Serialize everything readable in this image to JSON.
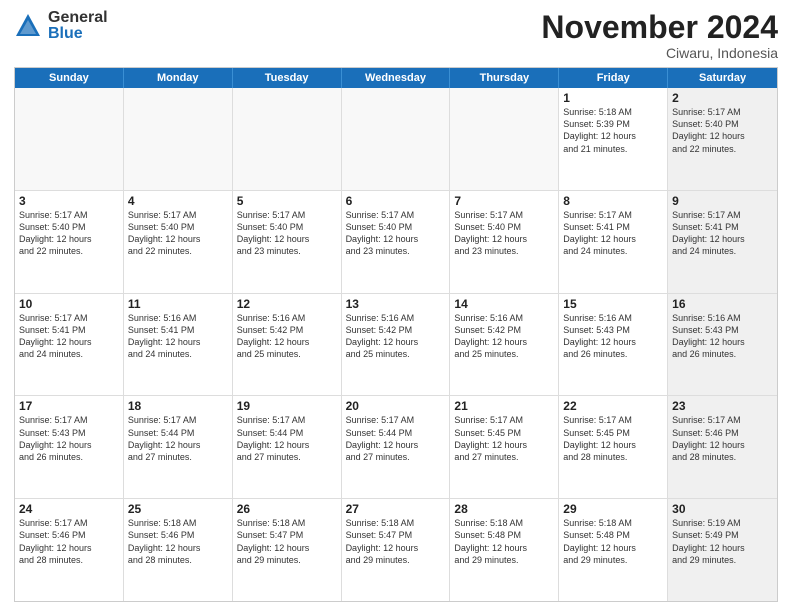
{
  "logo": {
    "general": "General",
    "blue": "Blue"
  },
  "header": {
    "month": "November 2024",
    "location": "Ciwaru, Indonesia"
  },
  "weekdays": [
    "Sunday",
    "Monday",
    "Tuesday",
    "Wednesday",
    "Thursday",
    "Friday",
    "Saturday"
  ],
  "rows": [
    [
      {
        "day": "",
        "empty": true
      },
      {
        "day": "",
        "empty": true
      },
      {
        "day": "",
        "empty": true
      },
      {
        "day": "",
        "empty": true
      },
      {
        "day": "",
        "empty": true
      },
      {
        "day": "1",
        "lines": [
          "Sunrise: 5:18 AM",
          "Sunset: 5:39 PM",
          "Daylight: 12 hours",
          "and 21 minutes."
        ]
      },
      {
        "day": "2",
        "shaded": true,
        "lines": [
          "Sunrise: 5:17 AM",
          "Sunset: 5:40 PM",
          "Daylight: 12 hours",
          "and 22 minutes."
        ]
      }
    ],
    [
      {
        "day": "3",
        "lines": [
          "Sunrise: 5:17 AM",
          "Sunset: 5:40 PM",
          "Daylight: 12 hours",
          "and 22 minutes."
        ]
      },
      {
        "day": "4",
        "lines": [
          "Sunrise: 5:17 AM",
          "Sunset: 5:40 PM",
          "Daylight: 12 hours",
          "and 22 minutes."
        ]
      },
      {
        "day": "5",
        "lines": [
          "Sunrise: 5:17 AM",
          "Sunset: 5:40 PM",
          "Daylight: 12 hours",
          "and 23 minutes."
        ]
      },
      {
        "day": "6",
        "lines": [
          "Sunrise: 5:17 AM",
          "Sunset: 5:40 PM",
          "Daylight: 12 hours",
          "and 23 minutes."
        ]
      },
      {
        "day": "7",
        "lines": [
          "Sunrise: 5:17 AM",
          "Sunset: 5:40 PM",
          "Daylight: 12 hours",
          "and 23 minutes."
        ]
      },
      {
        "day": "8",
        "lines": [
          "Sunrise: 5:17 AM",
          "Sunset: 5:41 PM",
          "Daylight: 12 hours",
          "and 24 minutes."
        ]
      },
      {
        "day": "9",
        "shaded": true,
        "lines": [
          "Sunrise: 5:17 AM",
          "Sunset: 5:41 PM",
          "Daylight: 12 hours",
          "and 24 minutes."
        ]
      }
    ],
    [
      {
        "day": "10",
        "lines": [
          "Sunrise: 5:17 AM",
          "Sunset: 5:41 PM",
          "Daylight: 12 hours",
          "and 24 minutes."
        ]
      },
      {
        "day": "11",
        "lines": [
          "Sunrise: 5:16 AM",
          "Sunset: 5:41 PM",
          "Daylight: 12 hours",
          "and 24 minutes."
        ]
      },
      {
        "day": "12",
        "lines": [
          "Sunrise: 5:16 AM",
          "Sunset: 5:42 PM",
          "Daylight: 12 hours",
          "and 25 minutes."
        ]
      },
      {
        "day": "13",
        "lines": [
          "Sunrise: 5:16 AM",
          "Sunset: 5:42 PM",
          "Daylight: 12 hours",
          "and 25 minutes."
        ]
      },
      {
        "day": "14",
        "lines": [
          "Sunrise: 5:16 AM",
          "Sunset: 5:42 PM",
          "Daylight: 12 hours",
          "and 25 minutes."
        ]
      },
      {
        "day": "15",
        "lines": [
          "Sunrise: 5:16 AM",
          "Sunset: 5:43 PM",
          "Daylight: 12 hours",
          "and 26 minutes."
        ]
      },
      {
        "day": "16",
        "shaded": true,
        "lines": [
          "Sunrise: 5:16 AM",
          "Sunset: 5:43 PM",
          "Daylight: 12 hours",
          "and 26 minutes."
        ]
      }
    ],
    [
      {
        "day": "17",
        "lines": [
          "Sunrise: 5:17 AM",
          "Sunset: 5:43 PM",
          "Daylight: 12 hours",
          "and 26 minutes."
        ]
      },
      {
        "day": "18",
        "lines": [
          "Sunrise: 5:17 AM",
          "Sunset: 5:44 PM",
          "Daylight: 12 hours",
          "and 27 minutes."
        ]
      },
      {
        "day": "19",
        "lines": [
          "Sunrise: 5:17 AM",
          "Sunset: 5:44 PM",
          "Daylight: 12 hours",
          "and 27 minutes."
        ]
      },
      {
        "day": "20",
        "lines": [
          "Sunrise: 5:17 AM",
          "Sunset: 5:44 PM",
          "Daylight: 12 hours",
          "and 27 minutes."
        ]
      },
      {
        "day": "21",
        "lines": [
          "Sunrise: 5:17 AM",
          "Sunset: 5:45 PM",
          "Daylight: 12 hours",
          "and 27 minutes."
        ]
      },
      {
        "day": "22",
        "lines": [
          "Sunrise: 5:17 AM",
          "Sunset: 5:45 PM",
          "Daylight: 12 hours",
          "and 28 minutes."
        ]
      },
      {
        "day": "23",
        "shaded": true,
        "lines": [
          "Sunrise: 5:17 AM",
          "Sunset: 5:46 PM",
          "Daylight: 12 hours",
          "and 28 minutes."
        ]
      }
    ],
    [
      {
        "day": "24",
        "lines": [
          "Sunrise: 5:17 AM",
          "Sunset: 5:46 PM",
          "Daylight: 12 hours",
          "and 28 minutes."
        ]
      },
      {
        "day": "25",
        "lines": [
          "Sunrise: 5:18 AM",
          "Sunset: 5:46 PM",
          "Daylight: 12 hours",
          "and 28 minutes."
        ]
      },
      {
        "day": "26",
        "lines": [
          "Sunrise: 5:18 AM",
          "Sunset: 5:47 PM",
          "Daylight: 12 hours",
          "and 29 minutes."
        ]
      },
      {
        "day": "27",
        "lines": [
          "Sunrise: 5:18 AM",
          "Sunset: 5:47 PM",
          "Daylight: 12 hours",
          "and 29 minutes."
        ]
      },
      {
        "day": "28",
        "lines": [
          "Sunrise: 5:18 AM",
          "Sunset: 5:48 PM",
          "Daylight: 12 hours",
          "and 29 minutes."
        ]
      },
      {
        "day": "29",
        "lines": [
          "Sunrise: 5:18 AM",
          "Sunset: 5:48 PM",
          "Daylight: 12 hours",
          "and 29 minutes."
        ]
      },
      {
        "day": "30",
        "shaded": true,
        "lines": [
          "Sunrise: 5:19 AM",
          "Sunset: 5:49 PM",
          "Daylight: 12 hours",
          "and 29 minutes."
        ]
      }
    ]
  ]
}
